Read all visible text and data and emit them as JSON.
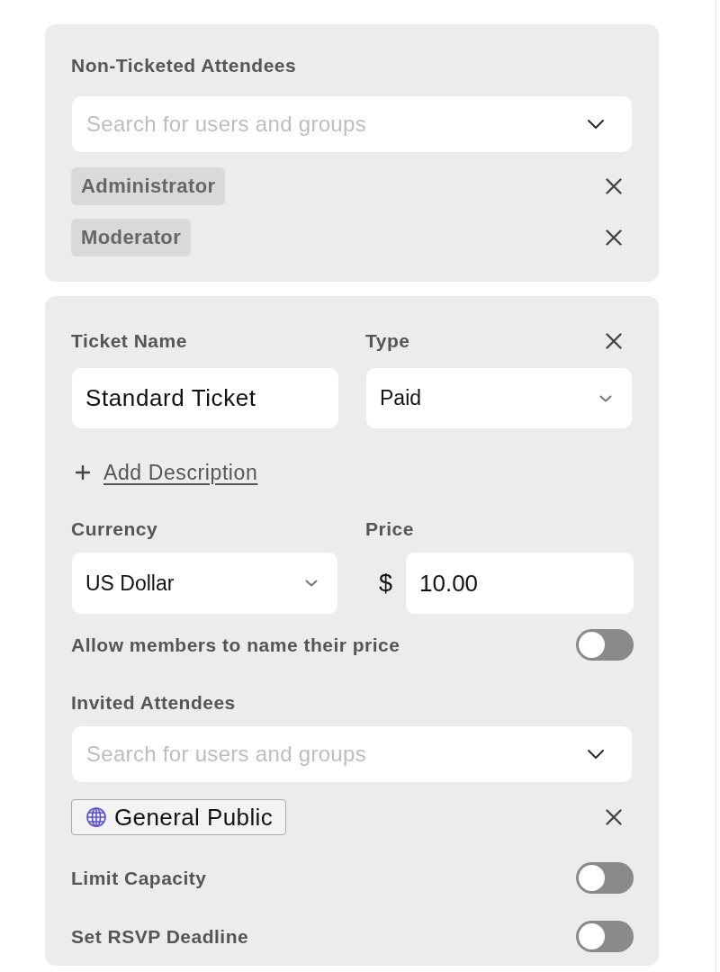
{
  "non_ticketed_attendees": {
    "title": "Non-Ticketed Attendees",
    "search": {
      "placeholder": "Search for users and groups"
    },
    "chips": [
      {
        "label": "Administrator",
        "kind": "role"
      },
      {
        "label": "Moderator",
        "kind": "role"
      }
    ]
  },
  "ticket": {
    "name_field": {
      "label": "Ticket Name",
      "value": "Standard Ticket"
    },
    "type_field": {
      "label": "Type",
      "value": "Paid"
    },
    "add_description": {
      "label": "Add Description"
    },
    "currency_field": {
      "label": "Currency",
      "value": "US Dollar"
    },
    "price_field": {
      "label": "Price",
      "symbol": "$",
      "value": "10.00"
    },
    "name_your_price": {
      "label": "Allow members to name their price",
      "on": false
    },
    "invited_attendees": {
      "title": "Invited Attendees",
      "search": {
        "placeholder": "Search for users and groups"
      },
      "chips": [
        {
          "label": "General Public",
          "kind": "audience"
        }
      ]
    },
    "toggles": [
      {
        "label": "Limit Capacity",
        "on": false
      },
      {
        "label": "Set RSVP Deadline",
        "on": false
      }
    ]
  }
}
